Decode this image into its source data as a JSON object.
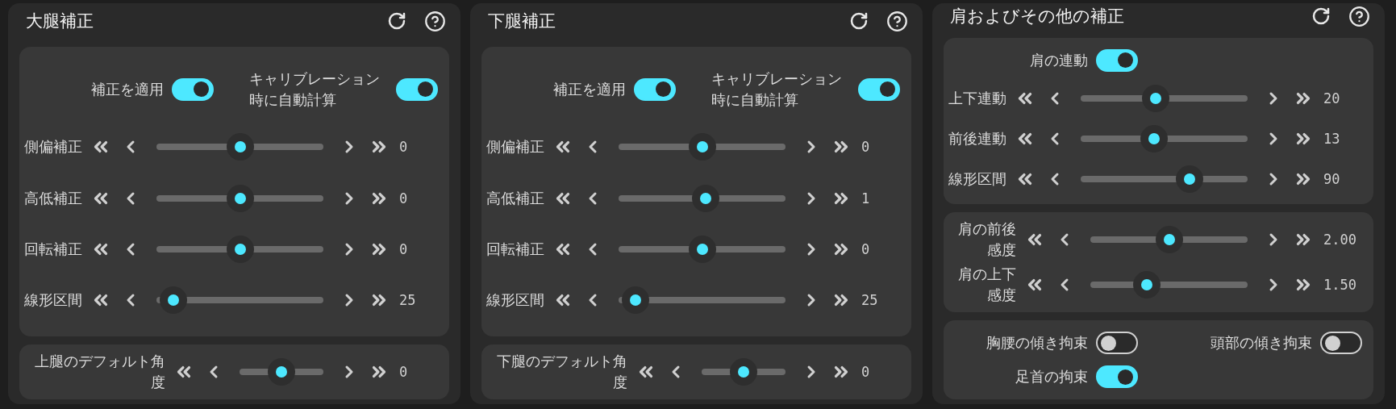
{
  "panels": [
    {
      "title": "大腿補正",
      "groups": [
        {
          "rows": [
            {
              "kind": "toggles",
              "toggles": [
                {
                  "label": "補正を適用",
                  "on": true
                },
                {
                  "label": "キャリブレーション時に自動計算",
                  "on": true
                }
              ]
            },
            {
              "kind": "slider",
              "label": "側偏補正",
              "level": 0.5,
              "reading": "0"
            },
            {
              "kind": "slider",
              "label": "高低補正",
              "level": 0.5,
              "reading": "0"
            },
            {
              "kind": "slider",
              "label": "回転補正",
              "level": 0.5,
              "reading": "0"
            },
            {
              "kind": "slider",
              "label": "線形区間",
              "level": 0.1,
              "reading": "25"
            }
          ]
        },
        {
          "rows": [
            {
              "kind": "slider",
              "label": "上腿のデフォルト角度",
              "level": 0.5,
              "reading": "0"
            }
          ]
        }
      ]
    },
    {
      "title": "下腿補正",
      "groups": [
        {
          "rows": [
            {
              "kind": "toggles",
              "toggles": [
                {
                  "label": "補正を適用",
                  "on": true
                },
                {
                  "label": "キャリブレーション時に自動計算",
                  "on": true
                }
              ]
            },
            {
              "kind": "slider",
              "label": "側偏補正",
              "level": 0.5,
              "reading": "0"
            },
            {
              "kind": "slider",
              "label": "高低補正",
              "level": 0.52,
              "reading": "1"
            },
            {
              "kind": "slider",
              "label": "回転補正",
              "level": 0.5,
              "reading": "0"
            },
            {
              "kind": "slider",
              "label": "線形区間",
              "level": 0.1,
              "reading": "25"
            }
          ]
        },
        {
          "rows": [
            {
              "kind": "slider",
              "label": "下腿のデフォルト角度",
              "level": 0.5,
              "reading": "0"
            }
          ]
        }
      ]
    },
    {
      "title": "肩およびその他の補正",
      "groups": [
        {
          "rows": [
            {
              "kind": "toggles",
              "toggles": [
                {
                  "label": "肩の連動",
                  "on": true
                }
              ]
            },
            {
              "kind": "slider",
              "label": "上下連動",
              "level": 0.45,
              "reading": "20"
            },
            {
              "kind": "slider",
              "label": "前後連動",
              "level": 0.44,
              "reading": "13"
            },
            {
              "kind": "slider",
              "label": "線形区間",
              "level": 0.65,
              "reading": "90"
            }
          ]
        },
        {
          "rows": [
            {
              "kind": "slider",
              "label": "肩の前後感度",
              "level": 0.5,
              "reading": "2.00"
            },
            {
              "kind": "slider",
              "label": "肩の上下感度",
              "level": 0.36,
              "reading": "1.50"
            }
          ]
        },
        {
          "rows": [
            {
              "kind": "toggles",
              "toggles": [
                {
                  "label": "胸腰の傾き拘束",
                  "on": false
                },
                {
                  "label": "頭部の傾き拘束",
                  "on": false
                },
                {
                  "label": "足首の拘束",
                  "on": true
                }
              ]
            }
          ]
        }
      ]
    }
  ]
}
